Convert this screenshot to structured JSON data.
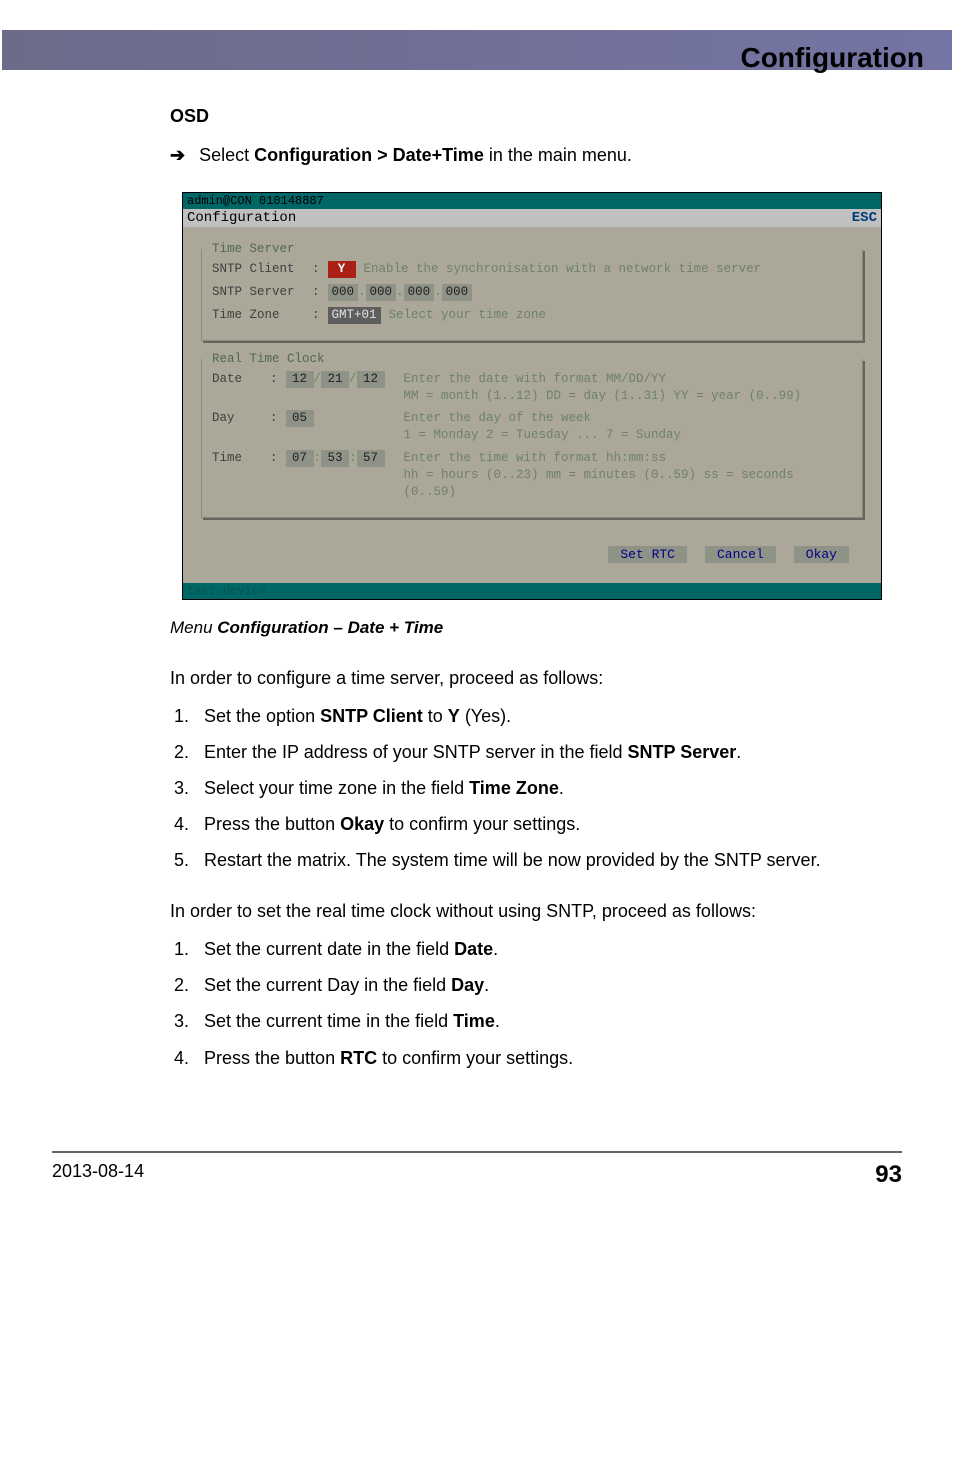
{
  "header": {
    "title": "Configuration"
  },
  "osd": {
    "heading": "OSD",
    "instruction_prefix": "Select ",
    "instruction_bold": "Configuration > Date+Time",
    "instruction_suffix": " in the main menu."
  },
  "terminal": {
    "topline": "admin@CON 010148887",
    "title": "Configuration",
    "esc": "ESC",
    "footer": "test-device",
    "time_server": {
      "legend": "Time Server",
      "sntp_client": {
        "label": "SNTP Client",
        "value": "Y",
        "hint": "Enable the synchronisation with a network time server"
      },
      "sntp_server": {
        "label": "SNTP Server",
        "o1": "000",
        "o2": "000",
        "o3": "000",
        "o4": "000"
      },
      "time_zone": {
        "label": "Time Zone",
        "value": "GMT+01",
        "hint": "Select your time zone"
      },
      "sep": ".",
      "colon": ":"
    },
    "rtc": {
      "legend": "Real Time Clock",
      "date": {
        "label": "Date",
        "mm": "12",
        "dd": "21",
        "yy": "12",
        "sep": "/",
        "hint1": "Enter the date with format MM/DD/YY",
        "hint2": "MM = month (1..12) DD = day (1..31) YY = year (0..99)"
      },
      "day": {
        "label": "Day",
        "value": "05",
        "hint1": "Enter the day of the week",
        "hint2": "1 = Monday 2 = Tuesday ... 7 = Sunday"
      },
      "time": {
        "label": "Time",
        "hh": "07",
        "mm": "53",
        "ss": "57",
        "sep": ":",
        "hint1": "Enter the time with format hh:mm:ss",
        "hint2": "hh = hours (0..23) mm = minutes (0..59) ss = seconds (0..59)"
      }
    },
    "buttons": {
      "set_rtc": "Set RTC",
      "cancel": "Cancel",
      "okay": "Okay"
    }
  },
  "caption": {
    "prefix": "Menu ",
    "bold": "Configuration – Date + Time"
  },
  "body": {
    "intro_a": "In order to configure a time server, proceed as follows:",
    "steps_a": [
      "__RAW__Set the option <strong>SNTP Client</strong> to <strong>Y</strong> (Yes).",
      "__RAW__Enter the IP address of your SNTP server in the field <strong>SNTP Server</strong>.",
      "__RAW__Select your time zone in the field <strong>Time Zone</strong>.",
      "__RAW__Press the button <strong>Okay</strong> to confirm your settings.",
      "Restart the matrix. The system time will be now provided by the SNTP server."
    ],
    "intro_b": "In order to set the real time clock without using SNTP, proceed as follows:",
    "steps_b": [
      "__RAW__Set the current date in the field <strong>Date</strong>.",
      "__RAW__Set the current Day in the field <strong>Day</strong>.",
      "__RAW__Set the current time in the field <strong>Time</strong>.",
      "__RAW__Press the button <strong>RTC</strong> to confirm your settings."
    ]
  },
  "footer": {
    "date": "2013-08-14",
    "page": "93"
  }
}
